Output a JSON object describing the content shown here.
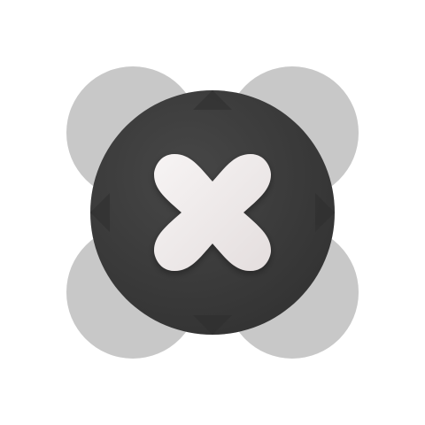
{
  "logo": {
    "icon": "x-mark-icon",
    "colors": {
      "background": "#ffffff",
      "petals": "#c8c8c8",
      "disc": "#3a3a3a",
      "disc_highlight": "#474747",
      "mark": "#f2eeee",
      "mark_shadow": "#d9d2d2"
    }
  }
}
